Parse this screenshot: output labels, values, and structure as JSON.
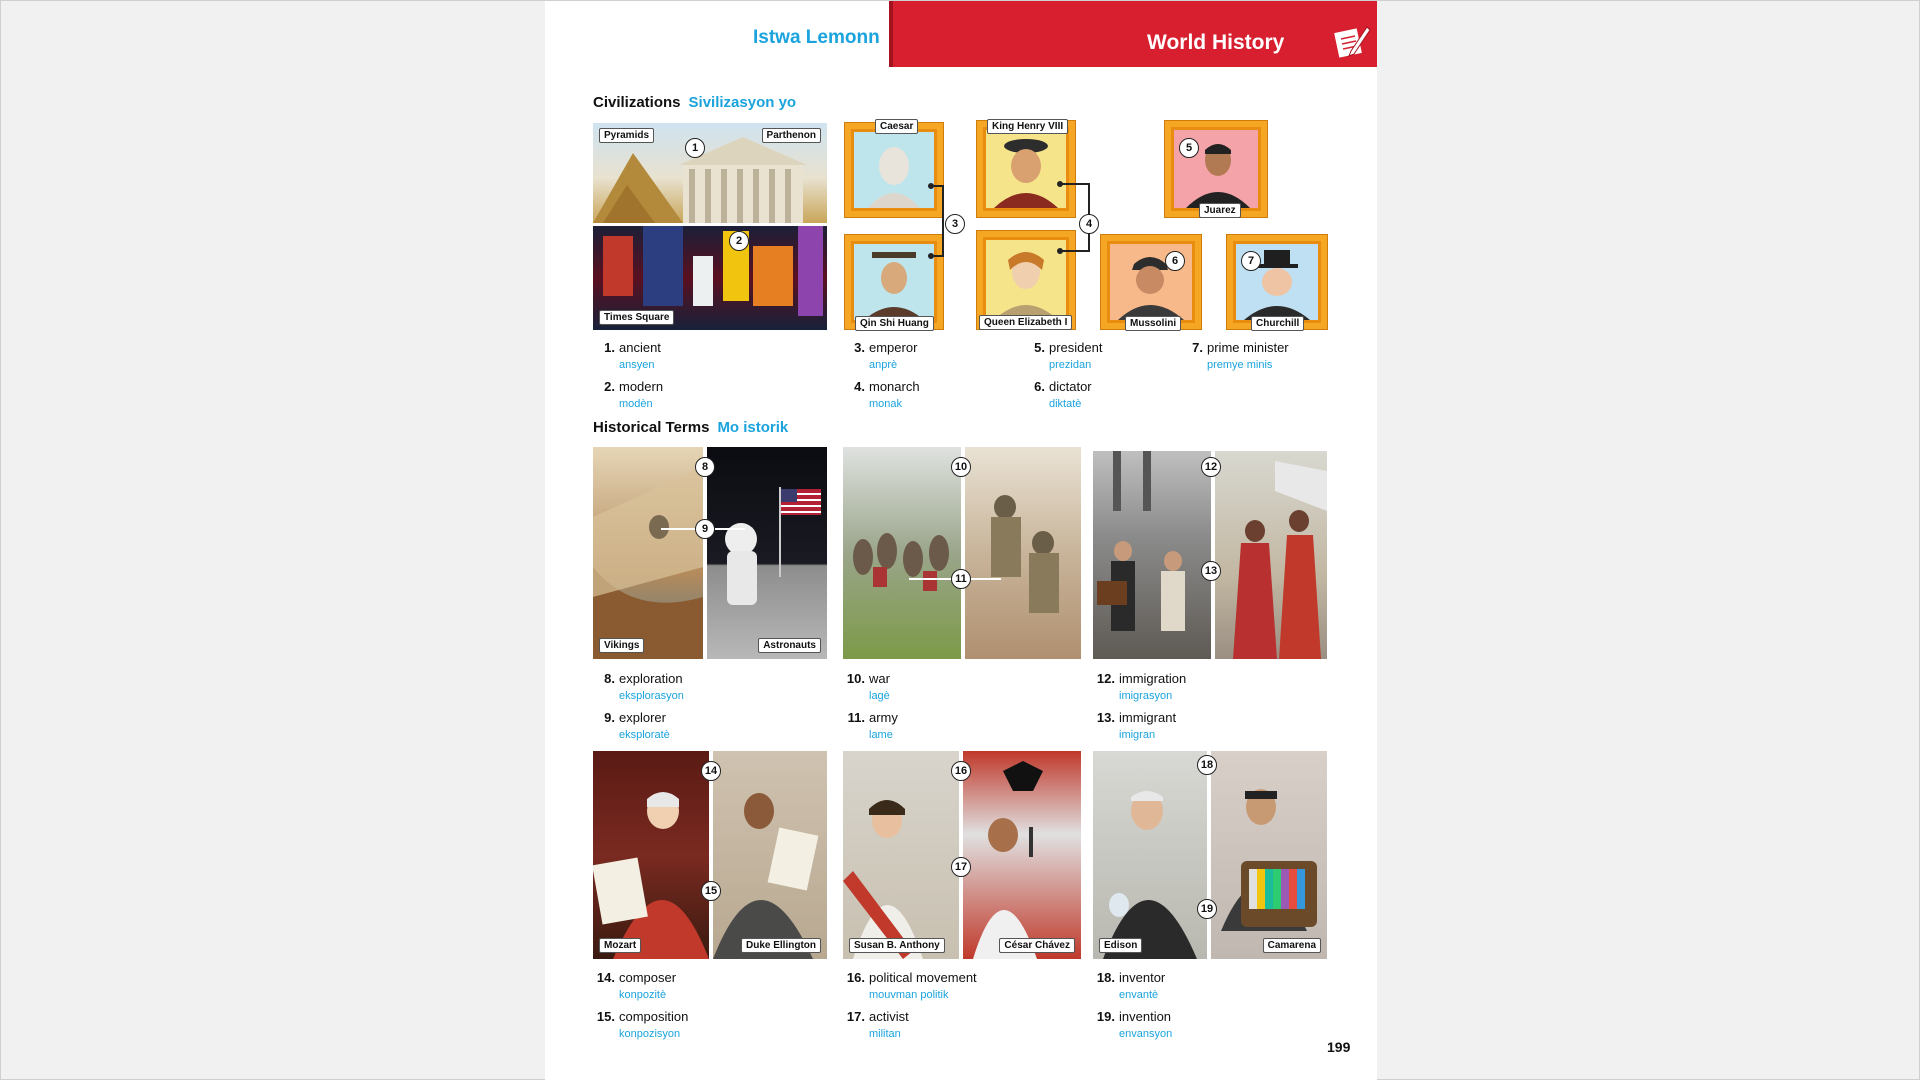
{
  "header": {
    "left_title": "Istwa Lemonn",
    "right_title": "World History"
  },
  "sections": {
    "civilizations": {
      "title": "Civilizations",
      "translation": "Sivilizasyon yo"
    },
    "historical_terms": {
      "title": "Historical Terms",
      "translation": "Mo istorik"
    }
  },
  "labels": {
    "pyramids": "Pyramids",
    "parthenon": "Parthenon",
    "times_square": "Times Square",
    "caesar": "Caesar",
    "qin_shi_huang": "Qin Shi Huang",
    "king_henry": "King Henry VIII",
    "queen_elizabeth": "Queen Elizabeth I",
    "juarez": "Juarez",
    "mussolini": "Mussolini",
    "churchill": "Churchill",
    "vikings": "Vikings",
    "astronauts": "Astronauts",
    "mozart": "Mozart",
    "duke_ellington": "Duke Ellington",
    "susan_anthony": "Susan B. Anthony",
    "cesar_chavez": "César Chávez",
    "edison": "Edison",
    "camarena": "Camarena"
  },
  "numbers": [
    "1",
    "2",
    "3",
    "4",
    "5",
    "6",
    "7",
    "8",
    "9",
    "10",
    "11",
    "12",
    "13",
    "14",
    "15",
    "16",
    "17",
    "18",
    "19"
  ],
  "entries": [
    {
      "n": "1.",
      "word": "ancient",
      "tr": "ansyen"
    },
    {
      "n": "2.",
      "word": "modern",
      "tr": "modèn"
    },
    {
      "n": "3.",
      "word": "emperor",
      "tr": "anprè"
    },
    {
      "n": "4.",
      "word": "monarch",
      "tr": "monak"
    },
    {
      "n": "5.",
      "word": "president",
      "tr": "prezidan"
    },
    {
      "n": "6.",
      "word": "dictator",
      "tr": "diktatè"
    },
    {
      "n": "7.",
      "word": "prime minister",
      "tr": "premye minis"
    },
    {
      "n": "8.",
      "word": "exploration",
      "tr": "eksplorasyon"
    },
    {
      "n": "9.",
      "word": "explorer",
      "tr": "eksploratè"
    },
    {
      "n": "10.",
      "word": "war",
      "tr": "lagè"
    },
    {
      "n": "11.",
      "word": "army",
      "tr": "lame"
    },
    {
      "n": "12.",
      "word": "immigration",
      "tr": "imigrasyon"
    },
    {
      "n": "13.",
      "word": "immigrant",
      "tr": "imigran"
    },
    {
      "n": "14.",
      "word": "composer",
      "tr": "konpozitè"
    },
    {
      "n": "15.",
      "word": "composition",
      "tr": "konpozisyon"
    },
    {
      "n": "16.",
      "word": "political movement",
      "tr": "mouvman politik"
    },
    {
      "n": "17.",
      "word": "activist",
      "tr": "militan"
    },
    {
      "n": "18.",
      "word": "inventor",
      "tr": "envantè"
    },
    {
      "n": "19.",
      "word": "invention",
      "tr": "envansyon"
    }
  ],
  "page_number": "199"
}
